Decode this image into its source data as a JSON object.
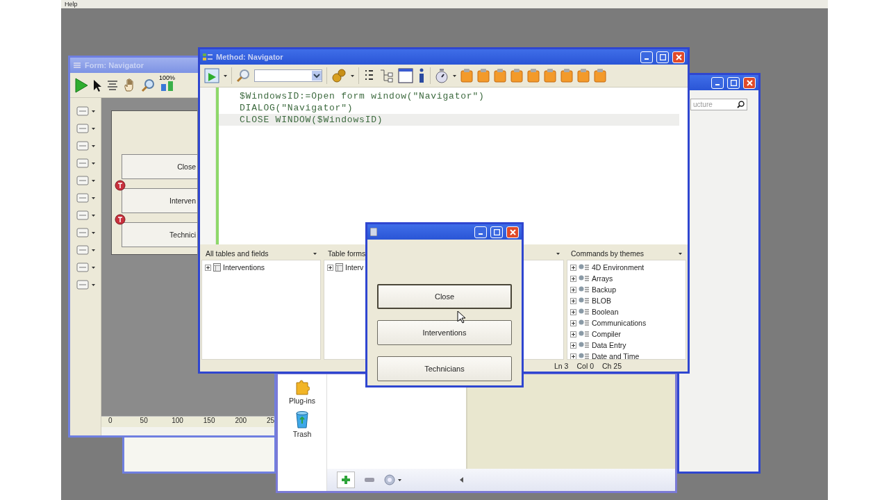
{
  "menu_bar": {
    "items": [
      "Help"
    ]
  },
  "form_window": {
    "title": "Form: Navigator",
    "zoom": "100%",
    "buttons": [
      {
        "label": "Close",
        "marked": false
      },
      {
        "label": "Interven",
        "marked": true
      },
      {
        "label": "Technici",
        "marked": true
      }
    ],
    "ruler": [
      "0",
      "50",
      "100",
      "150",
      "200",
      "25"
    ]
  },
  "structure_window": {
    "search": {
      "placeholder": "ucture"
    }
  },
  "method_window": {
    "title": "Method: Navigator",
    "code": [
      {
        "text": "$WindowsID:=Open form window(\"Navigator\")",
        "current": false
      },
      {
        "text": "DIALOG(\"Navigator\")",
        "current": false
      },
      {
        "text": "CLOSE WINDOW($WindowsID)",
        "current": true
      }
    ],
    "panes": [
      {
        "header": "All tables and fields",
        "items": [
          "Interventions"
        ]
      },
      {
        "header": "Table forms",
        "items": [
          "Interv"
        ]
      },
      {
        "header": "Commands by themes",
        "items": [
          "4D Environment",
          "Arrays",
          "Backup",
          "BLOB",
          "Boolean",
          "Communications",
          "Compiler",
          "Data Entry",
          "Date and Time"
        ]
      }
    ],
    "status": [
      "Ln 3",
      "Col 0",
      "Ch 25"
    ]
  },
  "dialog": {
    "buttons": [
      {
        "label": "Close",
        "focused": true
      },
      {
        "label": "Interventions",
        "focused": false
      },
      {
        "label": "Technicians",
        "focused": false
      }
    ]
  },
  "explorer": {
    "items": [
      "Plug-ins",
      "Trash"
    ]
  }
}
